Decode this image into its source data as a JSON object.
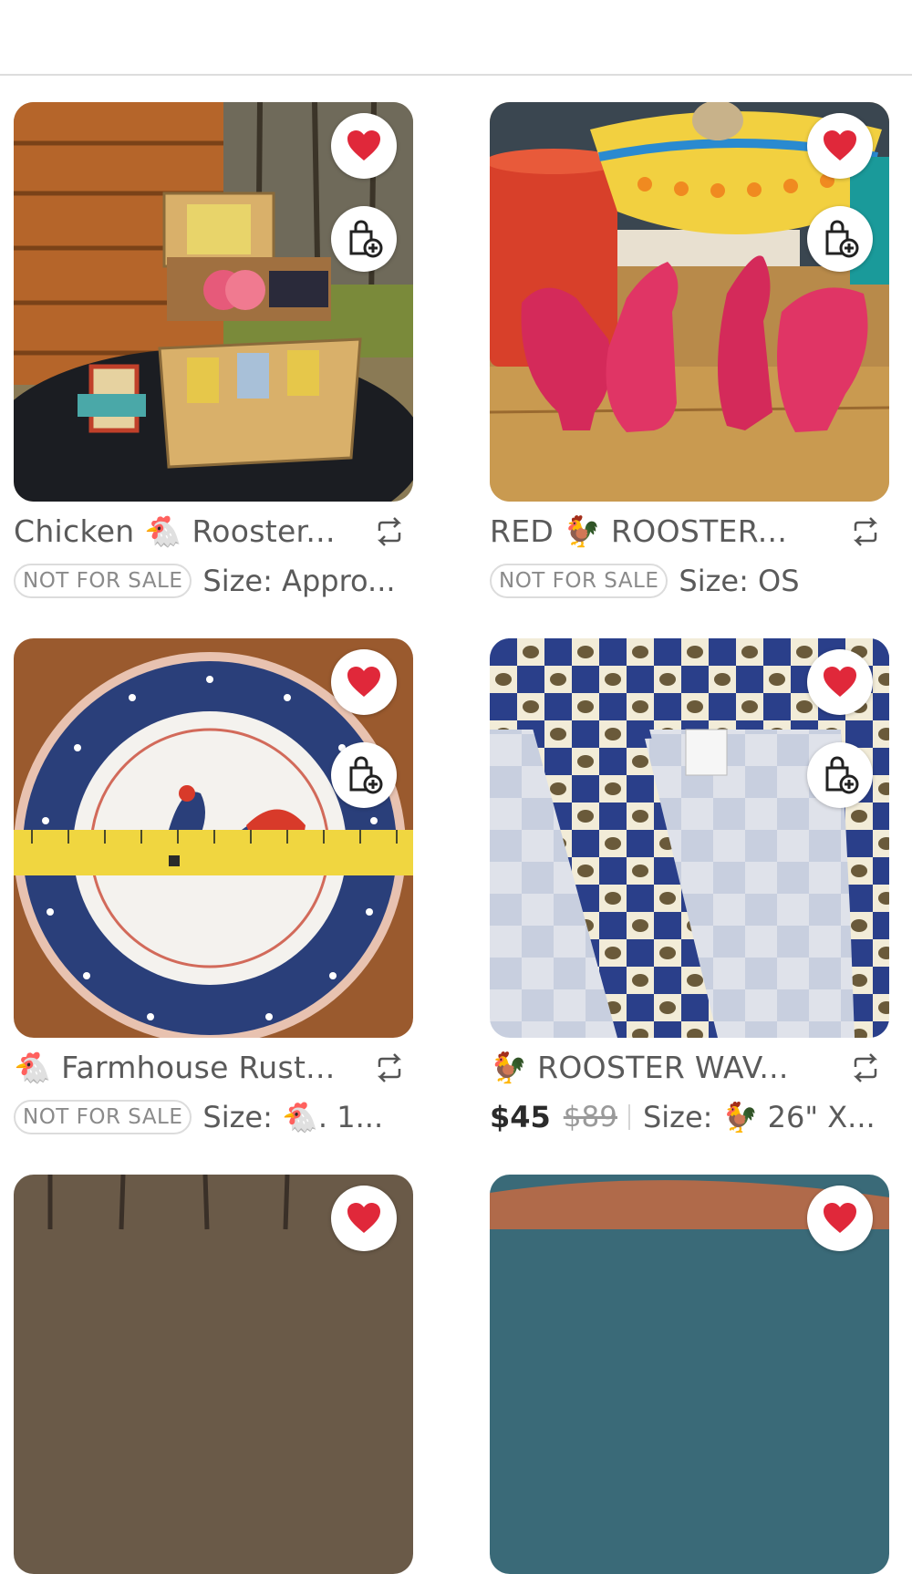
{
  "colors": {
    "like_red": "#e0283a",
    "divider": "#dddddd"
  },
  "icons": {
    "like": "heart-icon",
    "bundle": "bag-plus-icon",
    "share": "share-arrows-icon"
  },
  "listings": [
    {
      "title": "Chicken 🐔 Rooster...",
      "badge": "NOT FOR SALE",
      "size": "Size: Appro..."
    },
    {
      "title": "RED 🐓 ROOSTER...",
      "badge": "NOT FOR SALE",
      "size": "Size: OS"
    },
    {
      "title": "🐔  Farmhouse Rust...",
      "badge": "NOT FOR SALE",
      "size": "Size: 🐔. 1..."
    },
    {
      "title": "🐓 ROOSTER WAV...",
      "price": "$45",
      "original_price": "$89",
      "size": "Size: 🐓 26\" X..."
    }
  ]
}
